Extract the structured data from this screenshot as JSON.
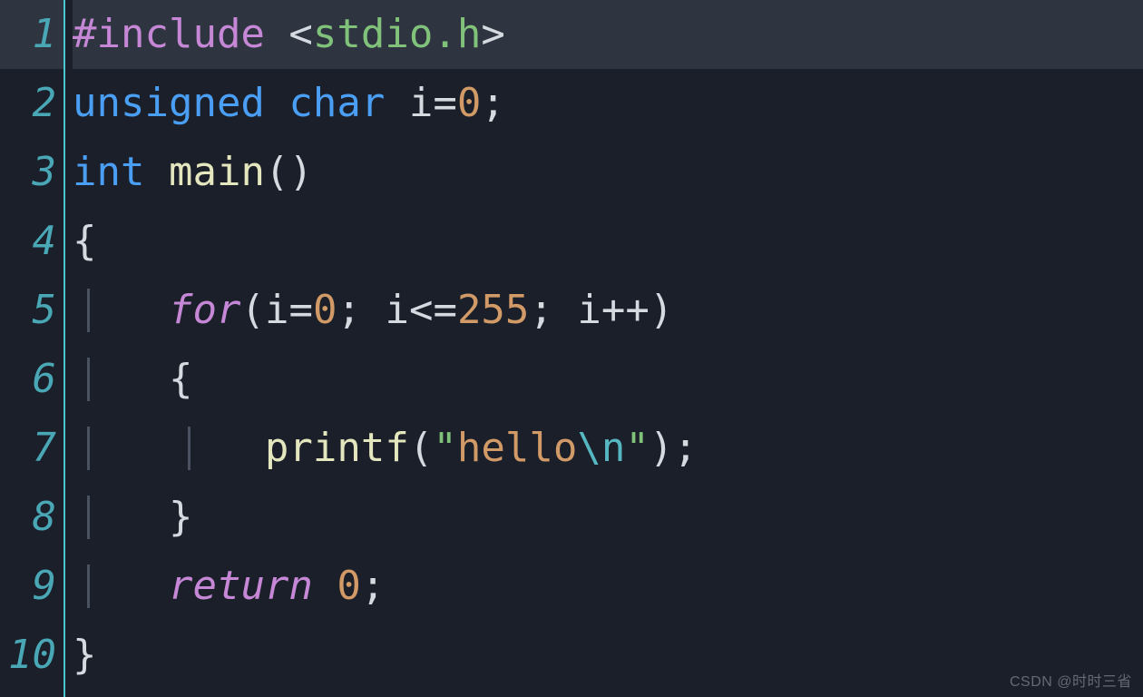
{
  "gutter": {
    "line_numbers": [
      "1",
      "2",
      "3",
      "4",
      "5",
      "6",
      "7",
      "8",
      "9",
      "10"
    ]
  },
  "code": {
    "l1": {
      "include": "#include",
      "open": " <",
      "header": "stdio.h",
      "close": ">"
    },
    "l2": {
      "kw1": "unsigned",
      "sp1": " ",
      "kw2": "char",
      "sp2": " ",
      "ident": "i",
      "eq": "=",
      "zero": "0",
      "semi": ";"
    },
    "l3": {
      "type": "int",
      "sp": " ",
      "fn": "main",
      "parens": "()"
    },
    "l4": {
      "brace": "{"
    },
    "l5": {
      "pad": "    ",
      "for": "for",
      "open": "(",
      "i1": "i",
      "eq": "=",
      "z": "0",
      "semi1": ";",
      "sp1": " ",
      "i2": "i",
      "le": "<=",
      "n": "255",
      "semi2": ";",
      "sp2": " ",
      "i3": "i",
      "pp": "++",
      "close": ")"
    },
    "l6": {
      "pad": "    ",
      "brace": "{"
    },
    "l7": {
      "pad": "        ",
      "fn": "printf",
      "open": "(",
      "q1": "\"",
      "body": "hello",
      "esc": "\\n",
      "q2": "\"",
      "close": ")",
      "semi": ";"
    },
    "l8": {
      "pad": "    ",
      "brace": "}"
    },
    "l9": {
      "pad": "    ",
      "ret": "return",
      "sp": " ",
      "z": "0",
      "semi": ";"
    },
    "l10": {
      "brace": "}"
    }
  },
  "watermark": "CSDN @时时三省"
}
